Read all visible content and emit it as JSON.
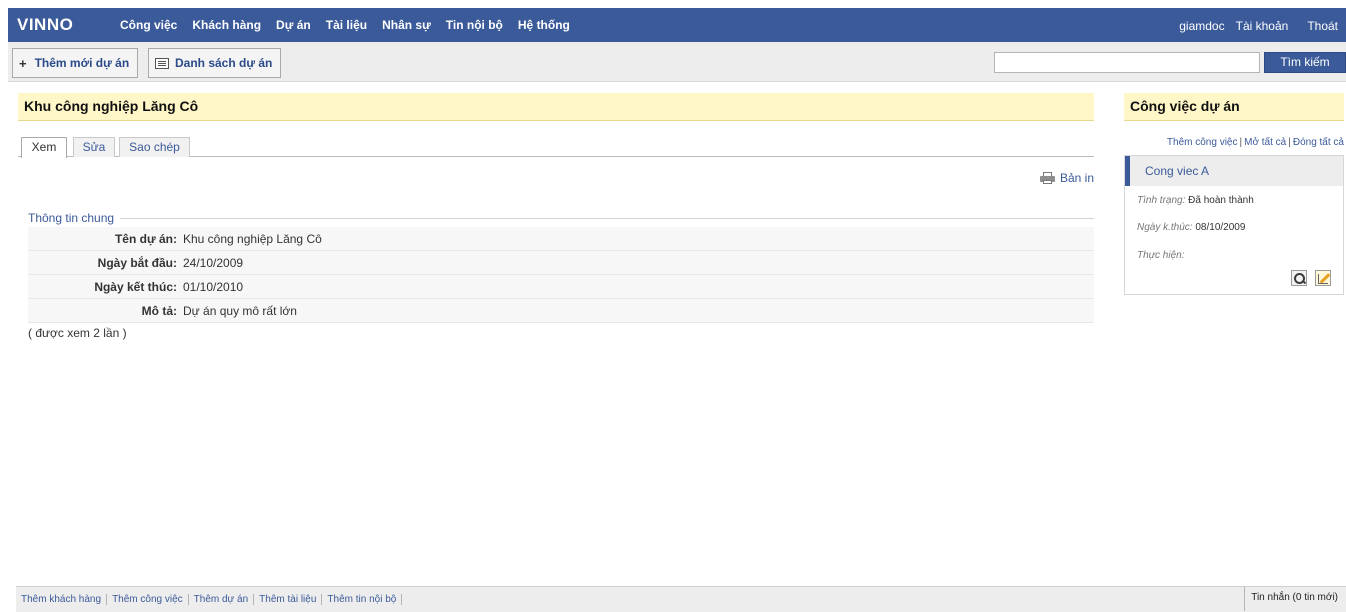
{
  "topbar": {
    "logo": "VINNO",
    "nav": [
      "Công việc",
      "Khách hàng",
      "Dự án",
      "Tài liệu",
      "Nhân sự",
      "Tin nội bộ",
      "Hệ thống"
    ],
    "user": "giamdoc",
    "account": "Tài khoản",
    "logout": "Thoát"
  },
  "toolbar": {
    "add_label": "Thêm mới dự án",
    "list_label": "Danh sách dự án",
    "search_value": "",
    "search_button": "Tìm kiếm"
  },
  "main": {
    "title": "Khu công nghiệp Lăng Cô",
    "tabs": [
      "Xem",
      "Sửa",
      "Sao chép"
    ],
    "print_label": "Bản in",
    "section_title": "Thông tin chung",
    "info": [
      {
        "label": "Tên dự án:",
        "value": "Khu công nghiệp Lăng Cô"
      },
      {
        "label": "Ngày bắt đầu:",
        "value": "24/10/2009"
      },
      {
        "label": "Ngày kết thúc:",
        "value": "01/10/2010"
      },
      {
        "label": "Mô tả:",
        "value": "Dự án quy mô rất lớn"
      }
    ],
    "view_count": "( được xem 2 lần )"
  },
  "sidebar": {
    "title": "Công việc dự án",
    "links": [
      "Thêm công việc",
      "Mở tất cả",
      "Đóng tất cả"
    ],
    "task": {
      "name": "Cong viec A",
      "status_label": "Tình trạng:",
      "status_value": "Đã hoàn thành",
      "end_label": "Ngày k.thúc:",
      "end_value": "08/10/2009",
      "assignee_label": "Thực hiện:",
      "assignee_value": ""
    }
  },
  "footer": {
    "links": [
      "Thêm khách hàng",
      "Thêm công việc",
      "Thêm dự án",
      "Thêm tài liệu",
      "Thêm tin nội bộ"
    ],
    "messages": "Tin nhắn (0 tin mới)"
  },
  "colors": {
    "nav_bg": "#3b5a9a",
    "title_bg": "#fff7c7",
    "link": "#3b5a9a"
  }
}
